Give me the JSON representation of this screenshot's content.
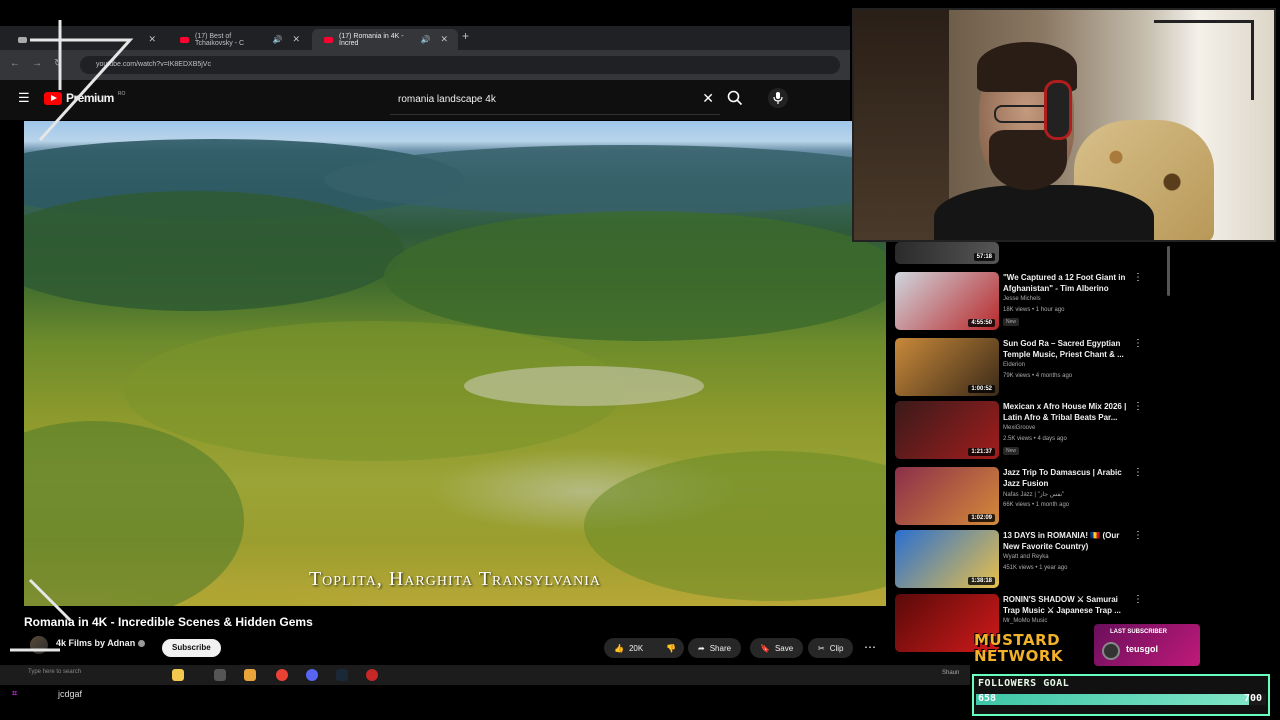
{
  "browser": {
    "tabs": [
      {
        "label": "(17) Best of Tchaikovsky - C"
      },
      {
        "label": "(17) Romania in 4K - Incred"
      }
    ],
    "url": "youtube.com/watch?v=IK8EDXB5jVc"
  },
  "youtube": {
    "logo_text": "Premium",
    "search_query": "romania landscape 4k"
  },
  "video": {
    "overlay_caption": "Toplita, Harghita Transylvania",
    "title": "Romania in 4K - Incredible Scenes & Hidden Gems",
    "channel": "4k Films by Adnan",
    "subscribe_label": "Subscribe",
    "likes": "20K",
    "share_label": "Share",
    "save_label": "Save",
    "clip_label": "Clip"
  },
  "recommendations": [
    {
      "title": "\"We Captured a 12 Foot Giant in Afghanistan\" - Tim Alberino",
      "channel": "Jesse Michels",
      "meta": "18K views • 1 hour ago",
      "badge": "New",
      "duration": "4:55:50",
      "color1": "#cfd6de",
      "color2": "#b8282a"
    },
    {
      "title": "Sun God Ra – Sacred Egyptian Temple Music, Priest Chant & ...",
      "channel": "Elderion",
      "meta": "79K views • 4 months ago",
      "badge": "",
      "duration": "1:00:52",
      "color1": "#c9893a",
      "color2": "#3a2a18"
    },
    {
      "title": "Mexican x Afro House Mix 2026 | Latin Afro & Tribal Beats Par...",
      "channel": "MexiGroove",
      "meta": "2.5K views • 4 days ago",
      "badge": "New",
      "duration": "1:21:37",
      "color1": "#3a1a1a",
      "color2": "#a11d1d"
    },
    {
      "title": "Jazz Trip To Damascus | Arabic Jazz Fusion",
      "channel": "Nafas Jazz | \"نفس جاز\"",
      "meta": "66K views • 1 month ago",
      "badge": "",
      "duration": "1:02:09",
      "color1": "#8a2f4a",
      "color2": "#d58a3a"
    },
    {
      "title": "13 DAYS in ROMANIA! 🇷🇴 (Our New Favorite Country)",
      "channel": "Wyatt and Reyka",
      "meta": "451K views • 1 year ago",
      "badge": "",
      "duration": "1:38:18",
      "color1": "#2a6fd0",
      "color2": "#e8c04a"
    },
    {
      "title": "RONIN'S SHADOW ⚔ Samurai Trap Music ⚔ Japanese Trap ...",
      "channel": "Mr_MoMo Music",
      "meta": "",
      "badge": "",
      "duration": "",
      "color1": "#5a0a0a",
      "color2": "#d01a1a"
    }
  ],
  "sidebar_top_duration": "57:18",
  "taskbar": {
    "search_placeholder": "Type here to search",
    "right_text": "Shaun"
  },
  "stream": {
    "bottom_name": "jcdgaf",
    "network_line1": "MUSTARD",
    "network_line2": "NETWORK",
    "last_subscriber_label": "LAST SUBSCRIBER",
    "last_subscriber_name": "teusgol",
    "followers_goal_label": "FOLLOWERS GOAL",
    "followers_current": "658",
    "followers_target": "700",
    "followers_progress": 0.94
  },
  "colors": {
    "yt_red": "#ff0000",
    "mustard": "#f2b22a",
    "goal_accent": "#3ec6a8"
  }
}
